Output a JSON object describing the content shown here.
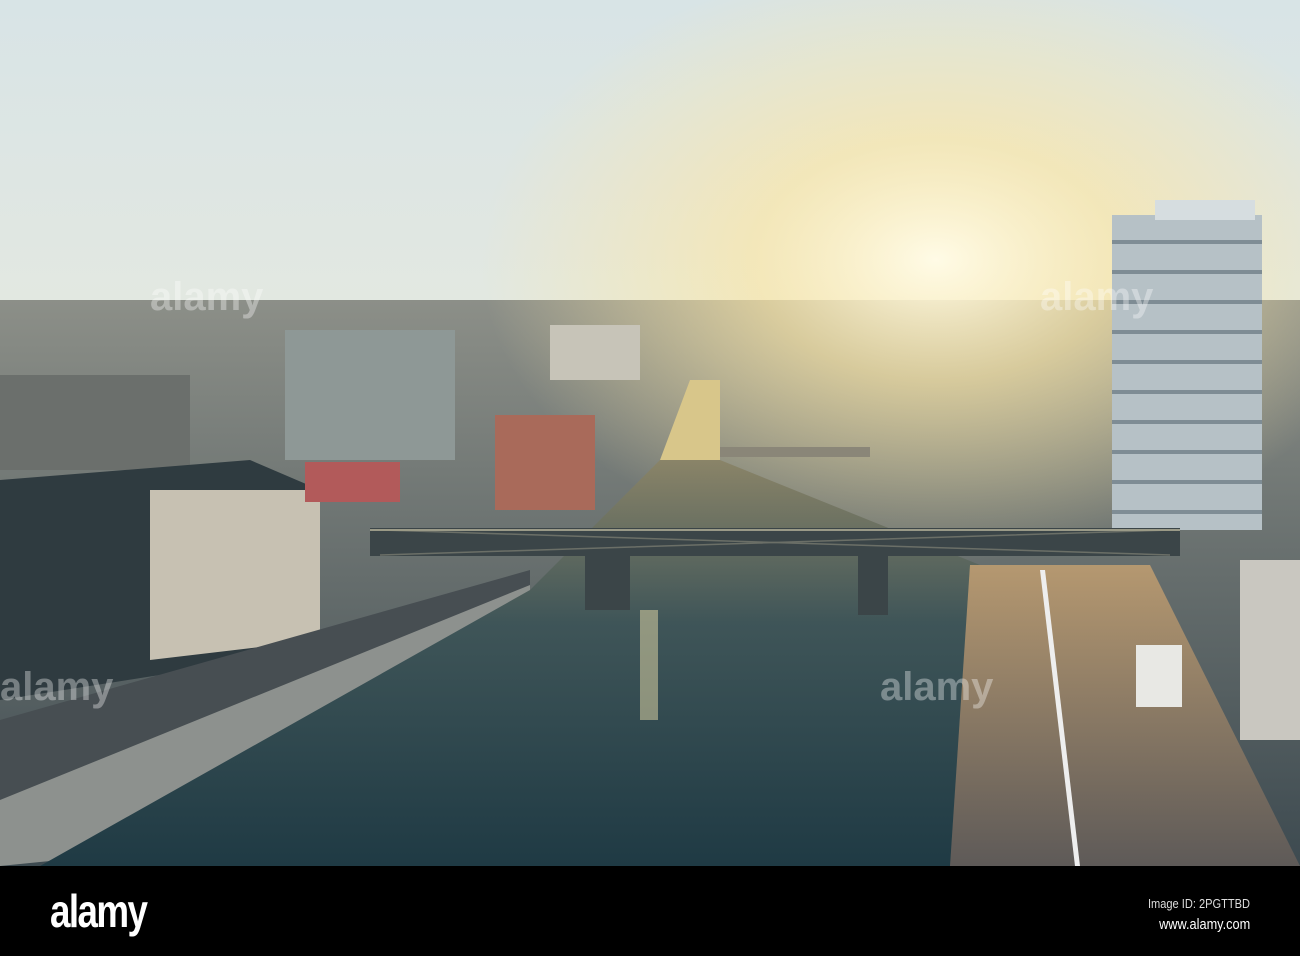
{
  "photo": {
    "subject": "Aerial view of river with bridges at sunset"
  },
  "watermark": {
    "text": "alamy"
  },
  "footer": {
    "logo": "alamy",
    "image_id": "Image ID: 2PGTTBD",
    "url": "www.alamy.com"
  }
}
